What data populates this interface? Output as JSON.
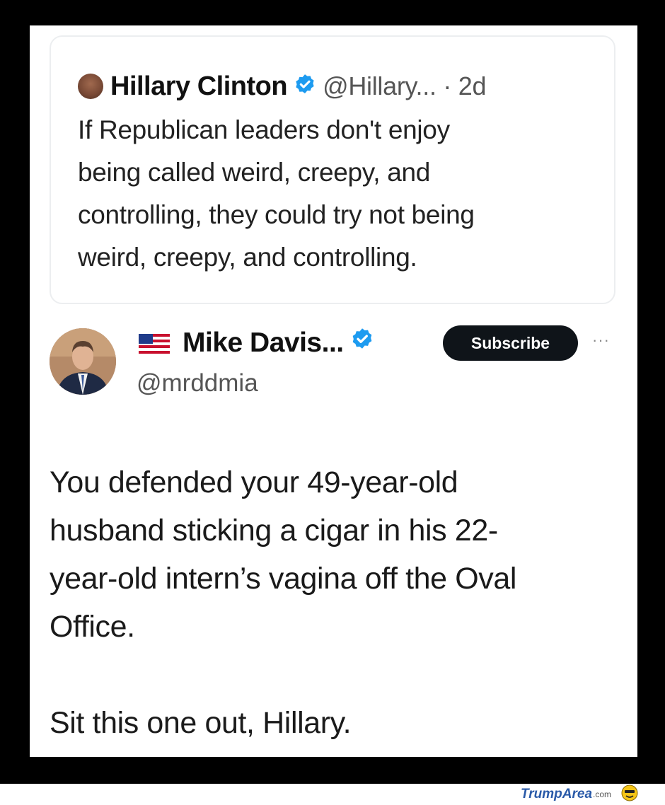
{
  "quoted_tweet": {
    "author_name": "Hillary Clinton",
    "handle_and_time": "@Hillary... · 2d",
    "lines": [
      "If Republican leaders don't enjoy",
      "being called weird, creepy, and",
      "controlling, they could try not being",
      "weird, creepy, and controlling."
    ]
  },
  "reply_tweet": {
    "author_name": "Mike Davis...",
    "handle": "@mrddmia",
    "subscribe_label": "Subscribe",
    "more_label": "···",
    "lines": [
      "You defended your 49-year-old",
      "husband sticking a cigar in his 22-",
      "year-old intern’s vagina off the Oval",
      "Office."
    ],
    "closing_line": "Sit this one out, Hillary."
  },
  "watermark": {
    "part1": "Trump",
    "part2": "Area",
    "suffix": ".com"
  },
  "colors": {
    "verified_blue": "#1d9bf0",
    "subscribe_bg": "#0f1419",
    "frame": "#000000",
    "watermark_blue": "#2a5aa8"
  },
  "icons": [
    "verified-badge-icon",
    "us-flag-icon",
    "more-options-icon",
    "smiley-face-icon"
  ]
}
